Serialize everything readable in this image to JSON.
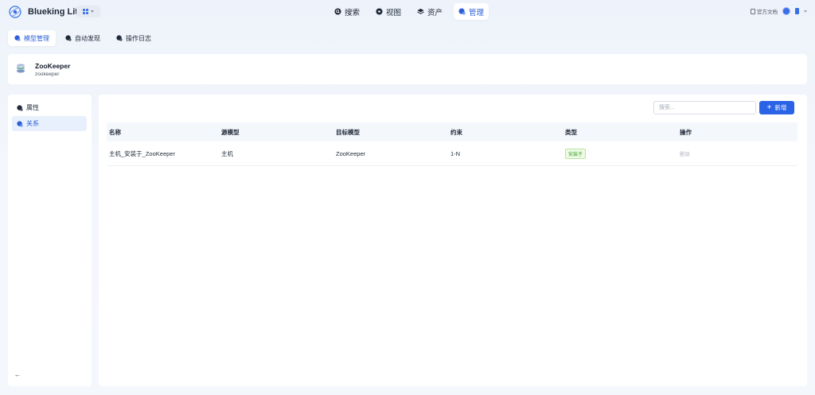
{
  "app": {
    "title": "Blueking Lite"
  },
  "nav": [
    {
      "label": "搜索",
      "icon": "search-icon",
      "active": false
    },
    {
      "label": "视图",
      "icon": "view-icon",
      "active": false
    },
    {
      "label": "资产",
      "icon": "layers-icon",
      "active": false
    },
    {
      "label": "管理",
      "icon": "manage-icon",
      "active": true
    }
  ],
  "top_right": {
    "docs_label": "官方文档"
  },
  "subtabs": [
    {
      "label": "模型管理",
      "active": true
    },
    {
      "label": "自动发现",
      "active": false
    },
    {
      "label": "操作日志",
      "active": false
    }
  ],
  "model": {
    "name": "ZooKeeper",
    "id": "zookeeper"
  },
  "sidebar": {
    "items": [
      {
        "label": "属性",
        "active": false
      },
      {
        "label": "关系",
        "active": true
      }
    ]
  },
  "toolbar": {
    "search_placeholder": "搜索...",
    "add_label": "新增"
  },
  "table": {
    "headers": [
      "名称",
      "源模型",
      "目标模型",
      "约束",
      "类型",
      "操作"
    ],
    "rows": [
      {
        "name": "主机_安装于_ZooKeeper",
        "source": "主机",
        "target": "ZooKeeper",
        "constraint": "1-N",
        "type": "安装于",
        "action": "删除"
      }
    ]
  },
  "colors": {
    "accent": "#2b63e6",
    "tag_green": "#3f9a24"
  }
}
